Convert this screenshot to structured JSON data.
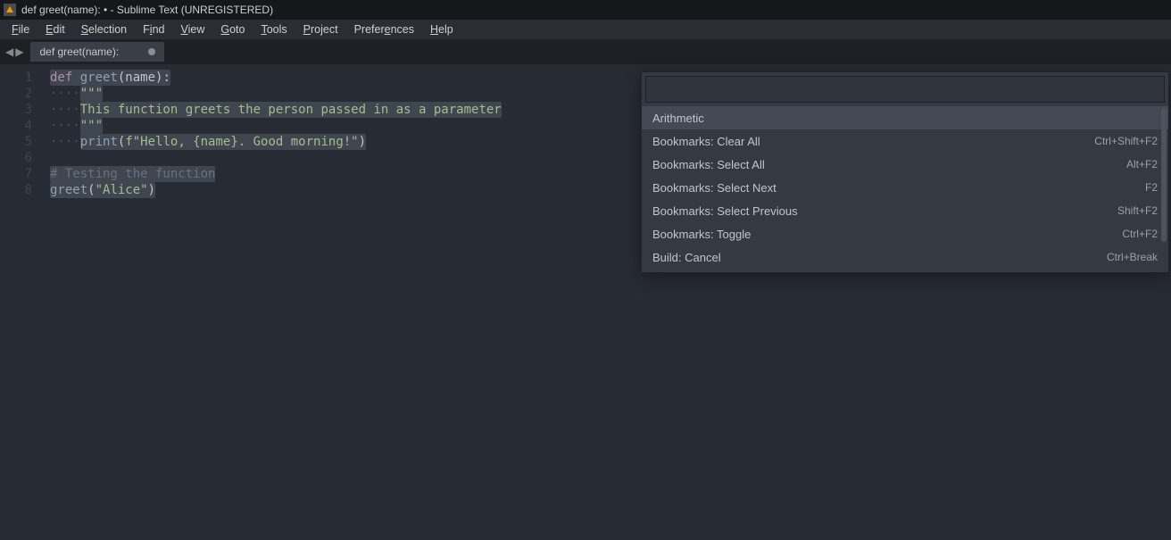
{
  "window": {
    "title": "def greet(name): • - Sublime Text (UNREGISTERED)"
  },
  "menubar": {
    "file": {
      "label": "File",
      "accel_index": 0
    },
    "edit": {
      "label": "Edit",
      "accel_index": 0
    },
    "selection": {
      "label": "Selection",
      "accel_index": 0
    },
    "find": {
      "label": "Find",
      "accel_index": 1
    },
    "view": {
      "label": "View",
      "accel_index": 0
    },
    "goto": {
      "label": "Goto",
      "accel_index": 0
    },
    "tools": {
      "label": "Tools",
      "accel_index": 0
    },
    "project": {
      "label": "Project",
      "accel_index": 0
    },
    "preferences": {
      "label": "Preferences",
      "accel_index": 6
    },
    "help": {
      "label": "Help",
      "accel_index": 0
    }
  },
  "tab": {
    "label": "def greet(name):",
    "unsaved": true
  },
  "code": {
    "line_count": 8,
    "lines": {
      "l1": "def greet(name):",
      "l2": "    \"\"\"",
      "l3": "    This function greets the person passed in as a parameter",
      "l4": "    \"\"\"",
      "l5": "    print(f\"Hello, {name}. Good morning!\")",
      "l6": "",
      "l7": "# Testing the function",
      "l8": "greet(\"Alice\")"
    }
  },
  "command_palette": {
    "input_value": "",
    "items": [
      {
        "label": "Arithmetic",
        "shortcut": ""
      },
      {
        "label": "Bookmarks: Clear All",
        "shortcut": "Ctrl+Shift+F2"
      },
      {
        "label": "Bookmarks: Select All",
        "shortcut": "Alt+F2"
      },
      {
        "label": "Bookmarks: Select Next",
        "shortcut": "F2"
      },
      {
        "label": "Bookmarks: Select Previous",
        "shortcut": "Shift+F2"
      },
      {
        "label": "Bookmarks: Toggle",
        "shortcut": "Ctrl+F2"
      },
      {
        "label": "Build: Cancel",
        "shortcut": "Ctrl+Break"
      }
    ],
    "selected_index": 0
  }
}
